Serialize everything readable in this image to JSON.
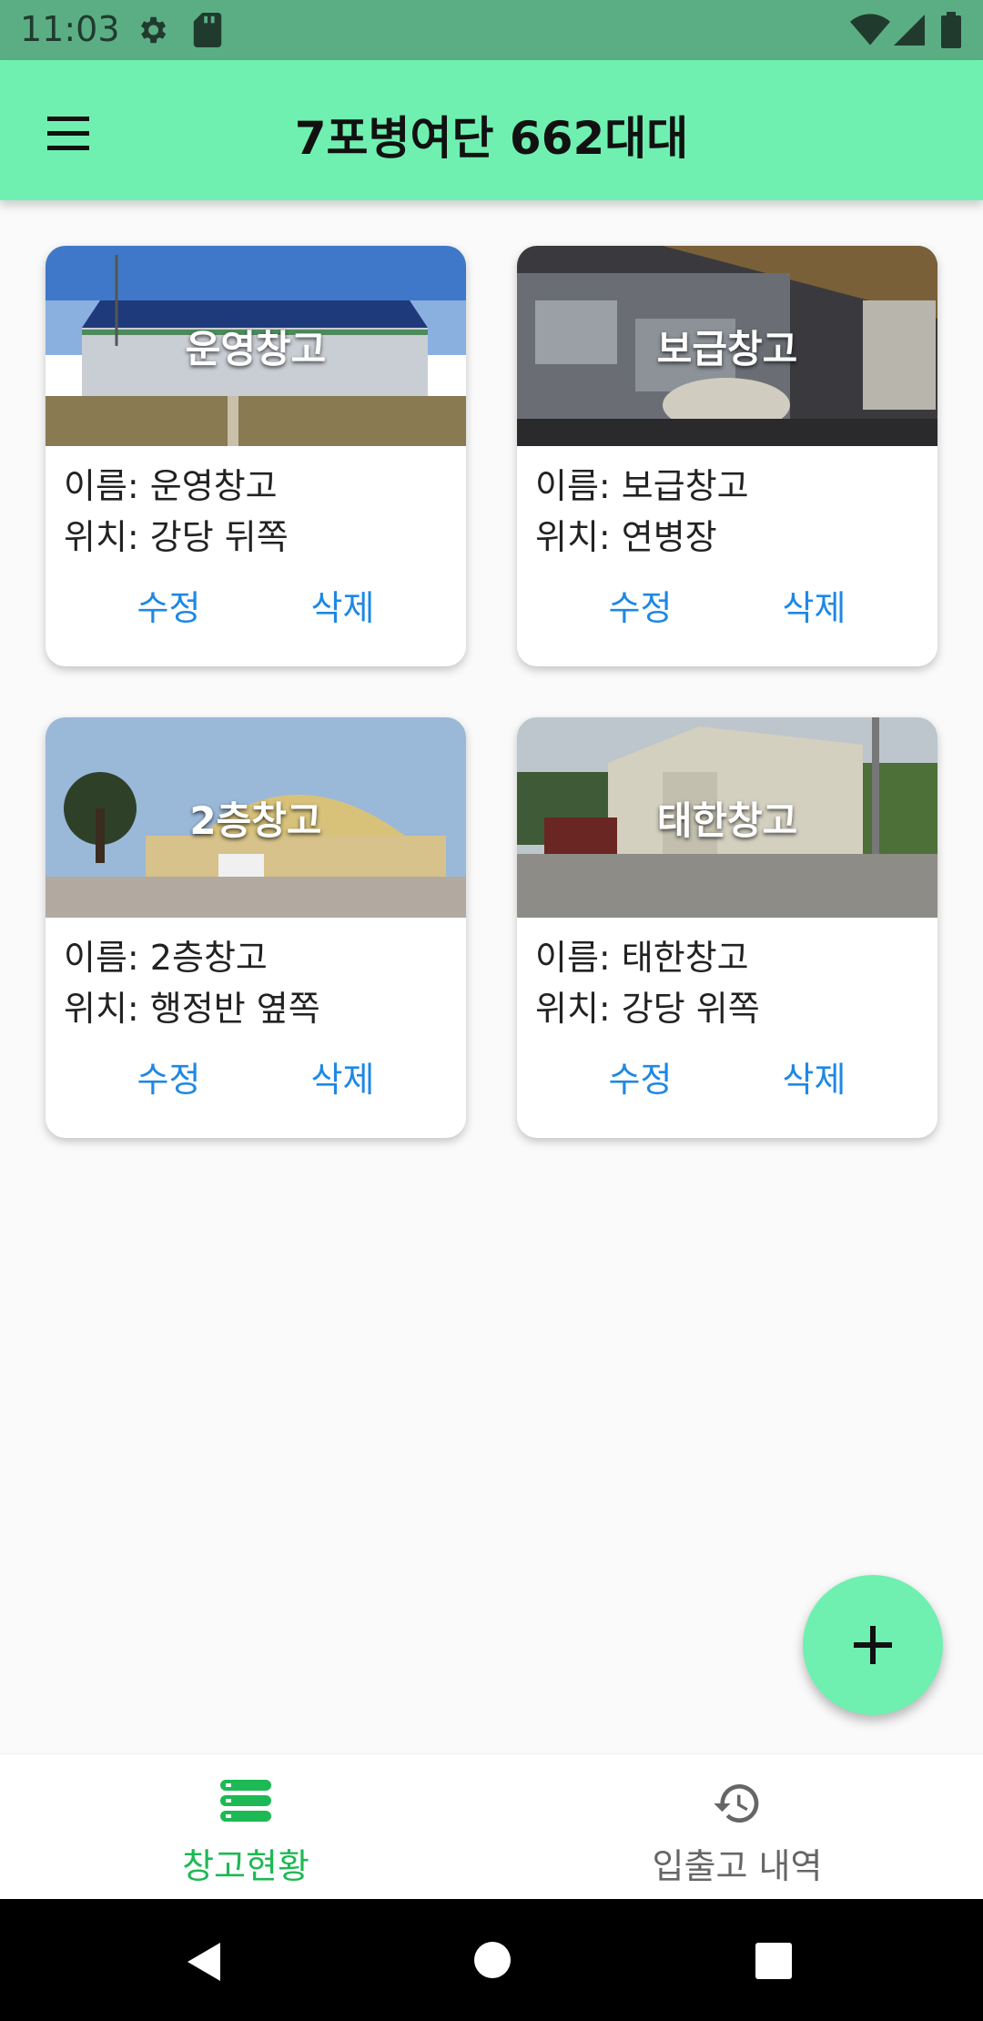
{
  "status_bar": {
    "time": "11:03"
  },
  "app_bar": {
    "title": "7포병여단 662대대"
  },
  "warehouses": [
    {
      "overlay": "운영창고",
      "name": "이름: 운영창고",
      "location": "위치: 강당 뒤쪽",
      "edit": "수정",
      "delete": "삭제"
    },
    {
      "overlay": "보급창고",
      "name": "이름: 보급창고",
      "location": "위치: 연병장",
      "edit": "수정",
      "delete": "삭제"
    },
    {
      "overlay": "2층창고",
      "name": "이름: 2층창고",
      "location": "위치: 행정반 옆쪽",
      "edit": "수정",
      "delete": "삭제"
    },
    {
      "overlay": "태한창고",
      "name": "이름: 태한창고",
      "location": "위치: 강당 위쪽",
      "edit": "수정",
      "delete": "삭제"
    }
  ],
  "bottom_nav": {
    "items": [
      {
        "label": "창고현황",
        "icon": "storage-icon",
        "active": true
      },
      {
        "label": "입출고 내역",
        "icon": "history-icon",
        "active": false
      }
    ]
  },
  "colors": {
    "accent": "#6ff0b0",
    "status_bar": "#5bae84",
    "active_nav": "#1db954",
    "link": "#1e88e5"
  }
}
